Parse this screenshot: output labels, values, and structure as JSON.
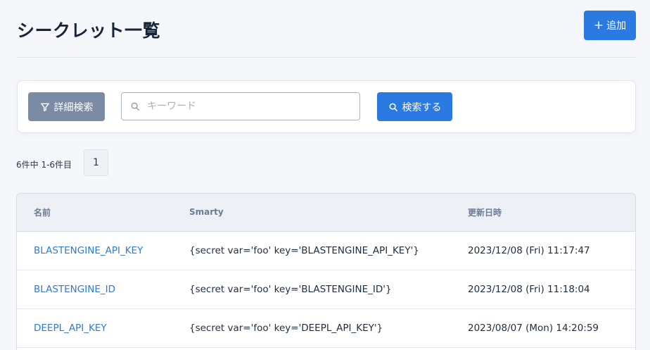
{
  "header": {
    "title": "シークレット一覧",
    "add_label": "追加"
  },
  "search": {
    "filter_label": "詳細検索",
    "placeholder": "キーワード",
    "value": "",
    "search_label": "検索する"
  },
  "pager": {
    "info": "6件中 1-6件目",
    "current_page": "1"
  },
  "table": {
    "headers": [
      "名前",
      "Smarty",
      "更新日時"
    ],
    "rows": [
      {
        "name": "BLASTENGINE_API_KEY",
        "smarty": "{secret var='foo' key='BLASTENGINE_API_KEY'}",
        "updated": "2023/12/08 (Fri) 11:17:47"
      },
      {
        "name": "BLASTENGINE_ID",
        "smarty": "{secret var='foo' key='BLASTENGINE_ID'}",
        "updated": "2023/12/08 (Fri) 11:18:04"
      },
      {
        "name": "DEEPL_API_KEY",
        "smarty": "{secret var='foo' key='DEEPL_API_KEY'}",
        "updated": "2023/08/07 (Mon) 14:20:59"
      }
    ]
  },
  "colors": {
    "primary": "#2a7ae2",
    "filter_button": "#7b8ba3",
    "link": "#2f7bd3"
  },
  "icons": {
    "add": "plus-icon",
    "filter": "funnel-icon",
    "search": "magnifier-icon"
  }
}
